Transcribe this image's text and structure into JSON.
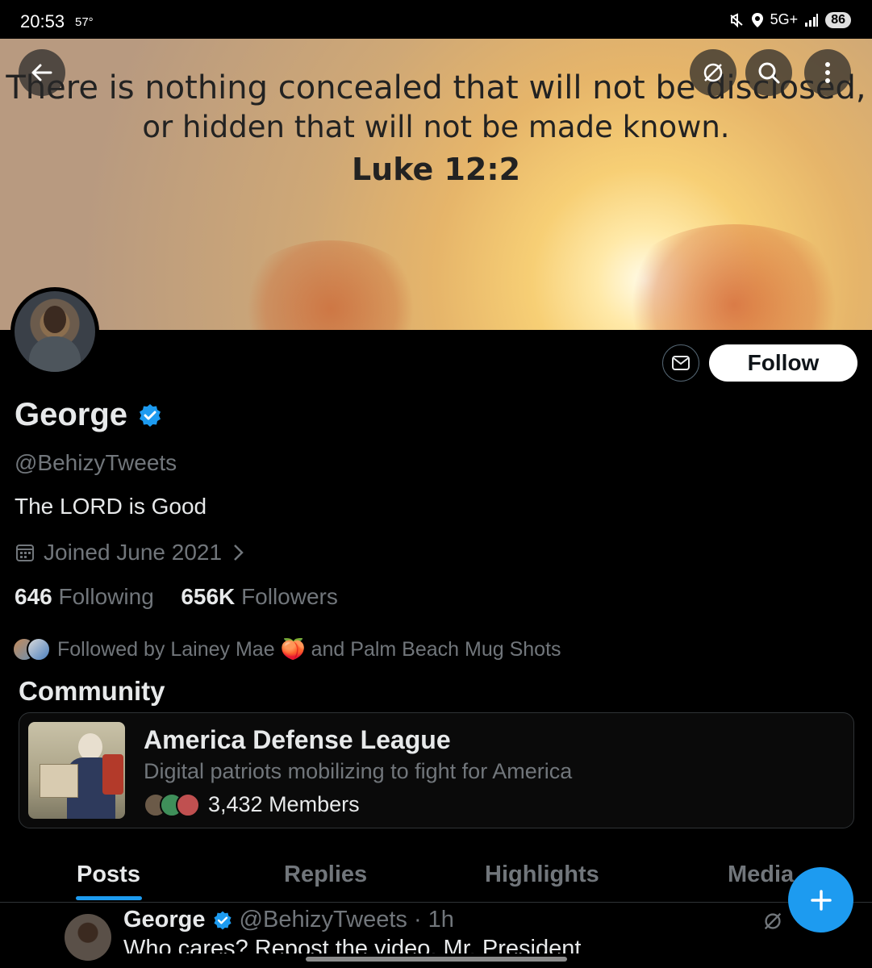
{
  "status_bar": {
    "time": "20:53",
    "temperature": "57°",
    "network": "5G+",
    "battery": "86"
  },
  "banner": {
    "line1": "There is nothing concealed that will not be disclosed,",
    "line2": "or hidden that will not be made known.",
    "line3": "Luke 12:2"
  },
  "profile": {
    "name": "George",
    "handle": "@BehizyTweets",
    "bio": "The LORD is Good",
    "joined": "Joined June 2021",
    "following_count": "646",
    "following_label": "Following",
    "followers_count": "656K",
    "followers_label": "Followers",
    "followed_by": "Followed by Lainey Mae 🍑 and Palm Beach Mug Shots",
    "follow_button": "Follow"
  },
  "community": {
    "section_title": "Community",
    "name": "America Defense League",
    "description": "Digital patriots mobilizing to fight for America",
    "members": "3,432 Members"
  },
  "tabs": [
    "Posts",
    "Replies",
    "Highlights",
    "Media"
  ],
  "post": {
    "author": "George",
    "handle_time": "@BehizyTweets · 1h",
    "text": "Who cares? Repost the video, Mr. President"
  },
  "colors": {
    "accent": "#1d9bf0",
    "background": "#000000",
    "muted_text": "#71767b"
  }
}
